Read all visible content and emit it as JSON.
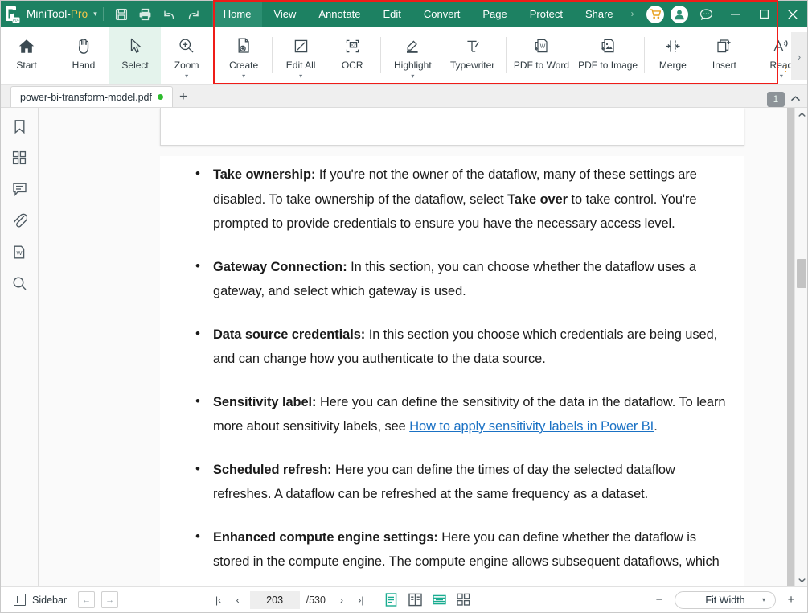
{
  "titlebar": {
    "brand_main": "MiniTool-",
    "brand_accent": "Pro",
    "caret": "▾",
    "icons": [
      {
        "name": "save-icon",
        "glyph": "save"
      },
      {
        "name": "print-icon",
        "glyph": "print"
      },
      {
        "name": "undo-icon",
        "glyph": "undo"
      },
      {
        "name": "redo-icon",
        "glyph": "redo"
      }
    ],
    "menu": [
      {
        "label": "Home",
        "active": true
      },
      {
        "label": "View",
        "active": false
      },
      {
        "label": "Annotate",
        "active": false
      },
      {
        "label": "Edit",
        "active": false
      },
      {
        "label": "Convert",
        "active": false
      },
      {
        "label": "Page",
        "active": false
      },
      {
        "label": "Protect",
        "active": false
      },
      {
        "label": "Share",
        "active": false
      }
    ],
    "menu_overflow": "›",
    "cart_label": "cart-icon",
    "account_label": "account-icon",
    "feedback_label": "feedback-icon",
    "minimize": "—",
    "maximize": "☐",
    "close": "✕",
    "accent_color": "#1d8162",
    "accent_active": "#2c8f72",
    "highlight_color": "#ef1c18"
  },
  "ribbon": {
    "buttons": [
      {
        "label": "Start",
        "icon": "home-icon",
        "caret": false,
        "selected": false,
        "divider_after": true
      },
      {
        "label": "Hand",
        "icon": "hand-icon",
        "caret": false,
        "selected": false,
        "divider_after": false
      },
      {
        "label": "Select",
        "icon": "cursor-icon",
        "caret": false,
        "selected": true,
        "divider_after": false
      },
      {
        "label": "Zoom",
        "icon": "magnifier-plus-icon",
        "caret": true,
        "selected": false,
        "divider_after": true
      },
      {
        "label": "Create",
        "icon": "new-file-icon",
        "caret": true,
        "selected": false,
        "divider_after": true
      },
      {
        "label": "Edit All",
        "icon": "edit-page-icon",
        "caret": true,
        "selected": false,
        "divider_after": false
      },
      {
        "label": "OCR",
        "icon": "ocr-icon",
        "caret": false,
        "selected": false,
        "divider_after": true
      },
      {
        "label": "Highlight",
        "icon": "highlighter-icon",
        "caret": true,
        "selected": false,
        "divider_after": false
      },
      {
        "label": "Typewriter",
        "icon": "typewriter-icon",
        "caret": false,
        "selected": false,
        "divider_after": true
      },
      {
        "label": "PDF to Word",
        "icon": "pdf-to-word-icon",
        "caret": false,
        "selected": false,
        "divider_after": false
      },
      {
        "label": "PDF to Image",
        "icon": "pdf-to-image-icon",
        "caret": false,
        "selected": false,
        "divider_after": true
      },
      {
        "label": "Merge",
        "icon": "merge-icon",
        "caret": false,
        "selected": false,
        "divider_after": false
      },
      {
        "label": "Insert",
        "icon": "insert-page-icon",
        "caret": false,
        "selected": false,
        "divider_after": true
      },
      {
        "label": "Read",
        "icon": "read-aloud-icon",
        "caret": true,
        "selected": false,
        "divider_after": false
      }
    ],
    "expand_glyph": "›",
    "selected_bg": "#e4f3ec"
  },
  "tabbar": {
    "document_name": "power-bi-transform-model.pdf",
    "modified_dot": true,
    "add_tab": "+",
    "page_badge": "1",
    "collapse_glyph": "⌃"
  },
  "left_rail": [
    {
      "name": "bookmark-icon",
      "label": "Bookmarks"
    },
    {
      "name": "thumbnails-icon",
      "label": "Thumbnails"
    },
    {
      "name": "comment-icon",
      "label": "Comments"
    },
    {
      "name": "attachment-icon",
      "label": "Attachments"
    },
    {
      "name": "word-icon",
      "label": "Word"
    },
    {
      "name": "search-icon",
      "label": "Search"
    }
  ],
  "document": {
    "bullets": [
      {
        "lead": "Take ownership:",
        "rest": " If you're not the owner of the dataflow, many of these settings are disabled. To take ownership of the dataflow, select ",
        "bold_mid": "Take over",
        "tail": " to take control. You're prompted to provide credentials to ensure you have the necessary access level."
      },
      {
        "lead": "Gateway Connection:",
        "rest": " In this section, you can choose whether the dataflow uses a gateway, and select which gateway is used.",
        "bold_mid": "",
        "tail": ""
      },
      {
        "lead": "Data source credentials:",
        "rest": " In this section you choose which credentials are being used, and can change how you authenticate to the data source.",
        "bold_mid": "",
        "tail": ""
      },
      {
        "lead": "Sensitivity label:",
        "rest": " Here you can define the sensitivity of the data in the dataflow. To learn more about sensitivity labels, see ",
        "link": "How to apply sensitivity labels in Power BI",
        "tail": "."
      },
      {
        "lead": "Scheduled refresh:",
        "rest": " Here you can define the times of day the selected dataflow refreshes. A dataflow can be refreshed at the same frequency as a dataset.",
        "bold_mid": "",
        "tail": ""
      },
      {
        "lead": "Enhanced compute engine settings:",
        "rest": " Here you can define whether the dataflow is stored in the compute engine. The compute engine allows subsequent dataflows, which reference this dataflow, to perform merges and joins and other",
        "bold_mid": "",
        "tail": ""
      }
    ],
    "link_color": "#1a71c4"
  },
  "statusbar": {
    "sidebar_label": "Sidebar",
    "nav_prev": "←",
    "nav_next": "→",
    "first_page": "|‹",
    "prev_page": "‹",
    "current_page": "203",
    "total_pages": "/530",
    "next_page": "›",
    "last_page": "›|",
    "view_modes": [
      {
        "name": "single-page-view-icon",
        "active": true
      },
      {
        "name": "two-page-view-icon",
        "active": false
      },
      {
        "name": "continuous-scroll-icon",
        "active": true
      },
      {
        "name": "grid-view-icon",
        "active": false
      }
    ],
    "zoom_out": "−",
    "zoom_level": "Fit Width",
    "zoom_caret": "▾",
    "zoom_in": "+",
    "active_mode_color": "#19ac90"
  }
}
